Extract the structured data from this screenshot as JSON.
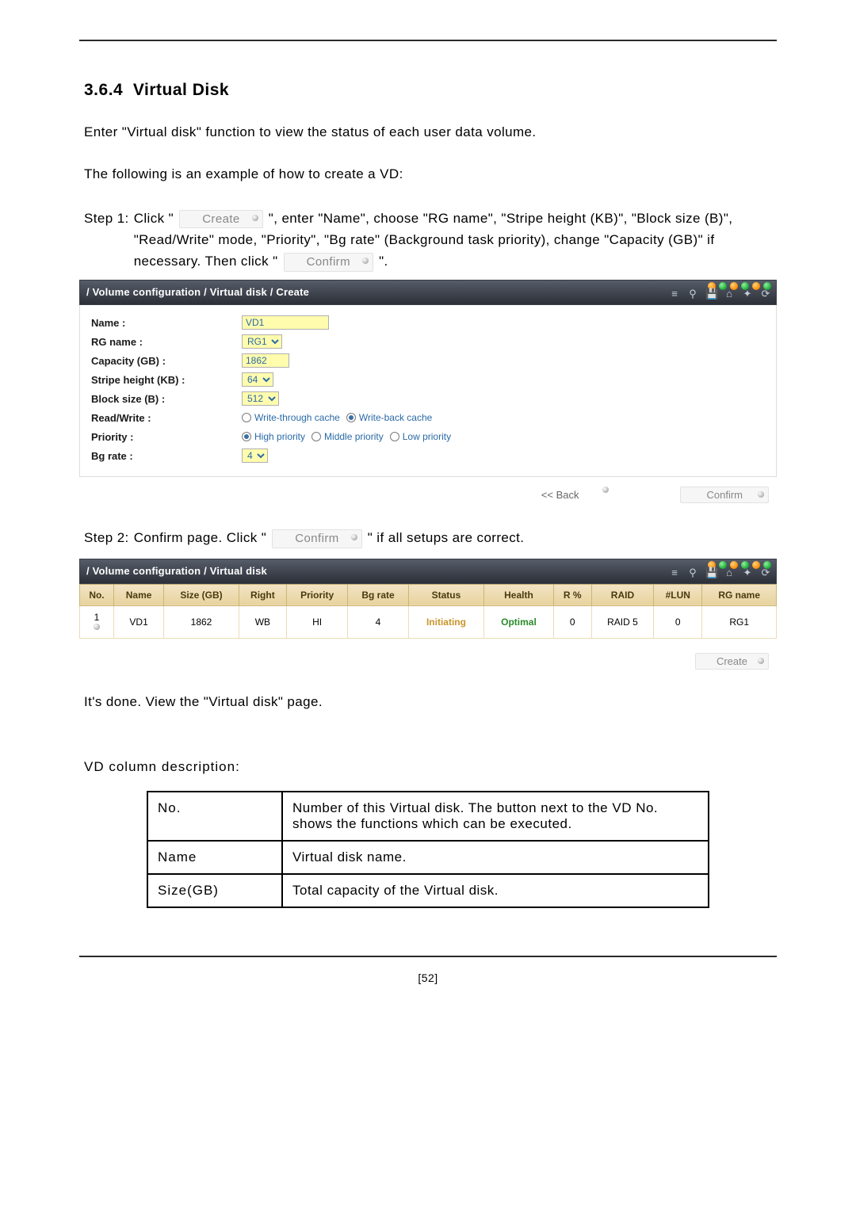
{
  "section": {
    "number": "3.6.4",
    "title": "Virtual Disk"
  },
  "intro1": "Enter \"Virtual disk\" function to view the status of each user data volume.",
  "intro2": "The following is an example of how to create a VD:",
  "step1": {
    "label": "Step 1:",
    "pre": "Click \"",
    "btn1": "Create",
    "mid": "\", enter \"Name\", choose \"RG name\", \"Stripe height (KB)\", \"Block size (B)\", \"Read/Write\" mode, \"Priority\", \"Bg rate\" (Background task priority), change \"Capacity (GB)\" if necessary. Then click \"",
    "btn2": "Confirm",
    "post": "\"."
  },
  "form": {
    "breadcrumb": "/ Volume configuration / Virtual disk / Create",
    "fields": {
      "name_label": "Name :",
      "name_value": "VD1",
      "rg_label": "RG name :",
      "rg_value": "RG1",
      "cap_label": "Capacity (GB) :",
      "cap_value": "1862",
      "stripe_label": "Stripe height (KB) :",
      "stripe_value": "64",
      "block_label": "Block size (B) :",
      "block_value": "512",
      "rw_label": "Read/Write :",
      "rw_opt1": "Write-through cache",
      "rw_opt2": "Write-back cache",
      "prio_label": "Priority :",
      "prio_opt1": "High priority",
      "prio_opt2": "Middle priority",
      "prio_opt3": "Low priority",
      "bg_label": "Bg rate :",
      "bg_value": "4"
    },
    "actions": {
      "back": "<< Back",
      "confirm": "Confirm"
    }
  },
  "step2": {
    "label": "Step 2:",
    "pre": "Confirm page. Click \"",
    "btn": "Confirm",
    "post": "\" if all setups are correct."
  },
  "table": {
    "breadcrumb": "/ Volume configuration / Virtual disk",
    "headers": [
      "No.",
      "Name",
      "Size (GB)",
      "Right",
      "Priority",
      "Bg rate",
      "Status",
      "Health",
      "R %",
      "RAID",
      "#LUN",
      "RG name"
    ],
    "row": {
      "no": "1",
      "name": "VD1",
      "size": "1862",
      "right": "WB",
      "priority": "HI",
      "bg": "4",
      "status": "Initiating",
      "health": "Optimal",
      "rpct": "0",
      "raid": "RAID 5",
      "lun": "0",
      "rg": "RG1"
    },
    "create_btn": "Create"
  },
  "done_text": "It's done. View the \"Virtual disk\" page.",
  "desc_title": "VD column description:",
  "desc_rows": [
    {
      "c1": "No.",
      "c2": "Number of this Virtual disk. The button next to the VD No. shows the functions which can be executed."
    },
    {
      "c1": "Name",
      "c2": "Virtual disk name."
    },
    {
      "c1": "Size(GB)",
      "c2": "Total capacity of the Virtual disk."
    }
  ],
  "page_number": "[52]"
}
